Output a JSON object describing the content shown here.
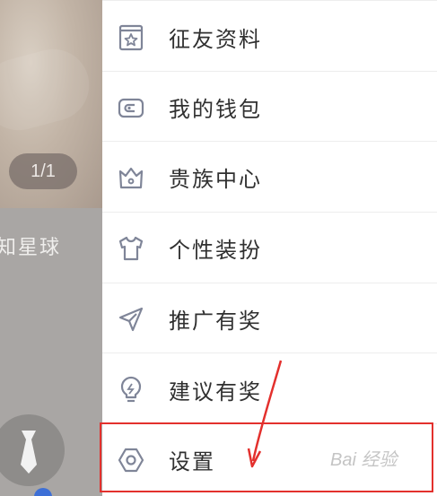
{
  "background": {
    "page_counter": "1/1",
    "planet_text": "知星球"
  },
  "menu": {
    "items": [
      {
        "label": "征友资料",
        "icon": "profile-star-icon"
      },
      {
        "label": "我的钱包",
        "icon": "wallet-icon"
      },
      {
        "label": "贵族中心",
        "icon": "crown-icon"
      },
      {
        "label": "个性装扮",
        "icon": "tshirt-icon"
      },
      {
        "label": "推广有奖",
        "icon": "paper-plane-icon"
      },
      {
        "label": "建议有奖",
        "icon": "lightbulb-icon"
      },
      {
        "label": "设置",
        "icon": "settings-hexagon-icon"
      }
    ]
  },
  "annotation": {
    "highlight_color": "#e3302d"
  },
  "watermark": "Bai 经验"
}
